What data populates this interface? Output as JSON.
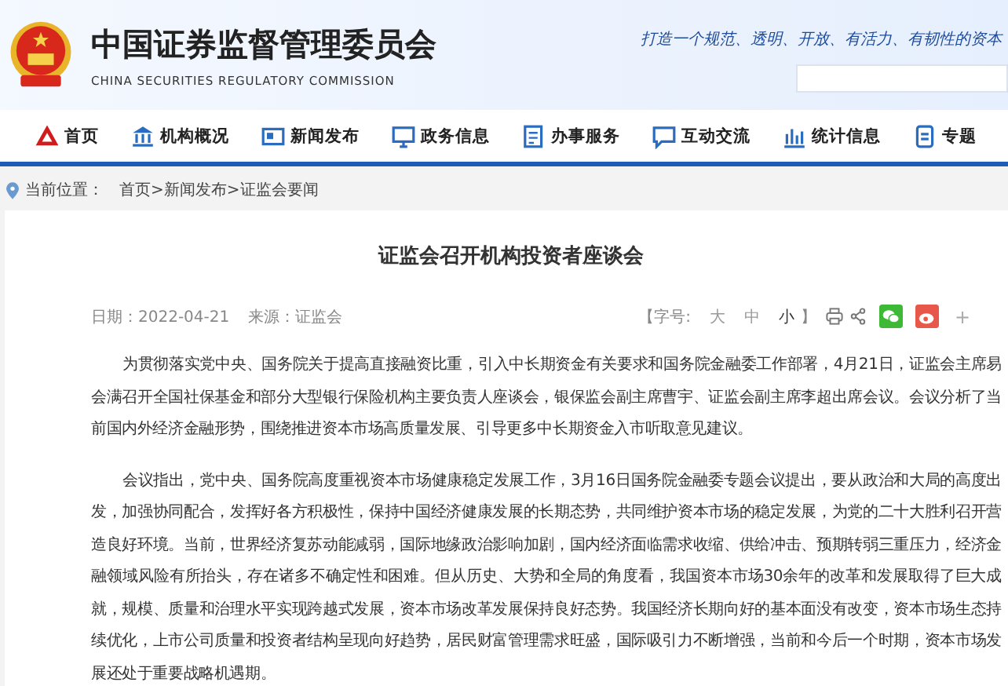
{
  "header": {
    "title": "中国证券监督管理委员会",
    "subtitle": "CHINA SECURITIES REGULATORY COMMISSION",
    "slogan": "打造一个规范、透明、开放、有活力、有韧性的资本"
  },
  "nav": [
    {
      "label": "首页"
    },
    {
      "label": "机构概况"
    },
    {
      "label": "新闻发布"
    },
    {
      "label": "政务信息"
    },
    {
      "label": "办事服务"
    },
    {
      "label": "互动交流"
    },
    {
      "label": "统计信息"
    },
    {
      "label": "专题"
    }
  ],
  "breadcrumb": {
    "label": "当前位置：",
    "path": "首页>新闻发布>证监会要闻"
  },
  "article": {
    "title": "证监会召开机构投资者座谈会",
    "date_label": "日期：",
    "date": "2022-04-21",
    "source_label": "来源：",
    "source": "证监会",
    "font_size_label": "【字号:",
    "font_sizes": [
      {
        "label": "大",
        "selected": false
      },
      {
        "label": "中",
        "selected": false
      },
      {
        "label": "小",
        "selected": true
      }
    ],
    "font_size_end": "】",
    "plus": "+",
    "paragraphs": [
      "为贯彻落实党中央、国务院关于提高直接融资比重，引入中长期资金有关要求和国务院金融委工作部署，4月21日，证监会主席易会满召开全国社保基金和部分大型银行保险机构主要负责人座谈会，银保监会副主席曹宇、证监会副主席李超出席会议。会议分析了当前国内外经济金融形势，围绕推进资本市场高质量发展、引导更多中长期资金入市听取意见建议。",
      "会议指出，党中央、国务院高度重视资本市场健康稳定发展工作，3月16日国务院金融委专题会议提出，要从政治和大局的高度出发，加强协同配合，发挥好各方积极性，保持中国经济健康发展的长期态势，共同维护资本市场的稳定发展，为党的二十大胜利召开营造良好环境。当前，世界经济复苏动能减弱，国际地缘政治影响加剧，国内经济面临需求收缩、供给冲击、预期转弱三重压力，经济金融领域风险有所抬头，存在诸多不确定性和困难。但从历史、大势和全局的角度看，我国资本市场30余年的改革和发展取得了巨大成就，规模、质量和治理水平实现跨越式发展，资本市场改革发展保持良好态势。我国经济长期向好的基本面没有改变，资本市场生态持续优化，上市公司质量和投资者结构呈现向好趋势，居民财富管理需求旺盛，国际吸引力不断增强，当前和今后一个时期，资本市场发展还处于重要战略机遇期。"
    ]
  }
}
